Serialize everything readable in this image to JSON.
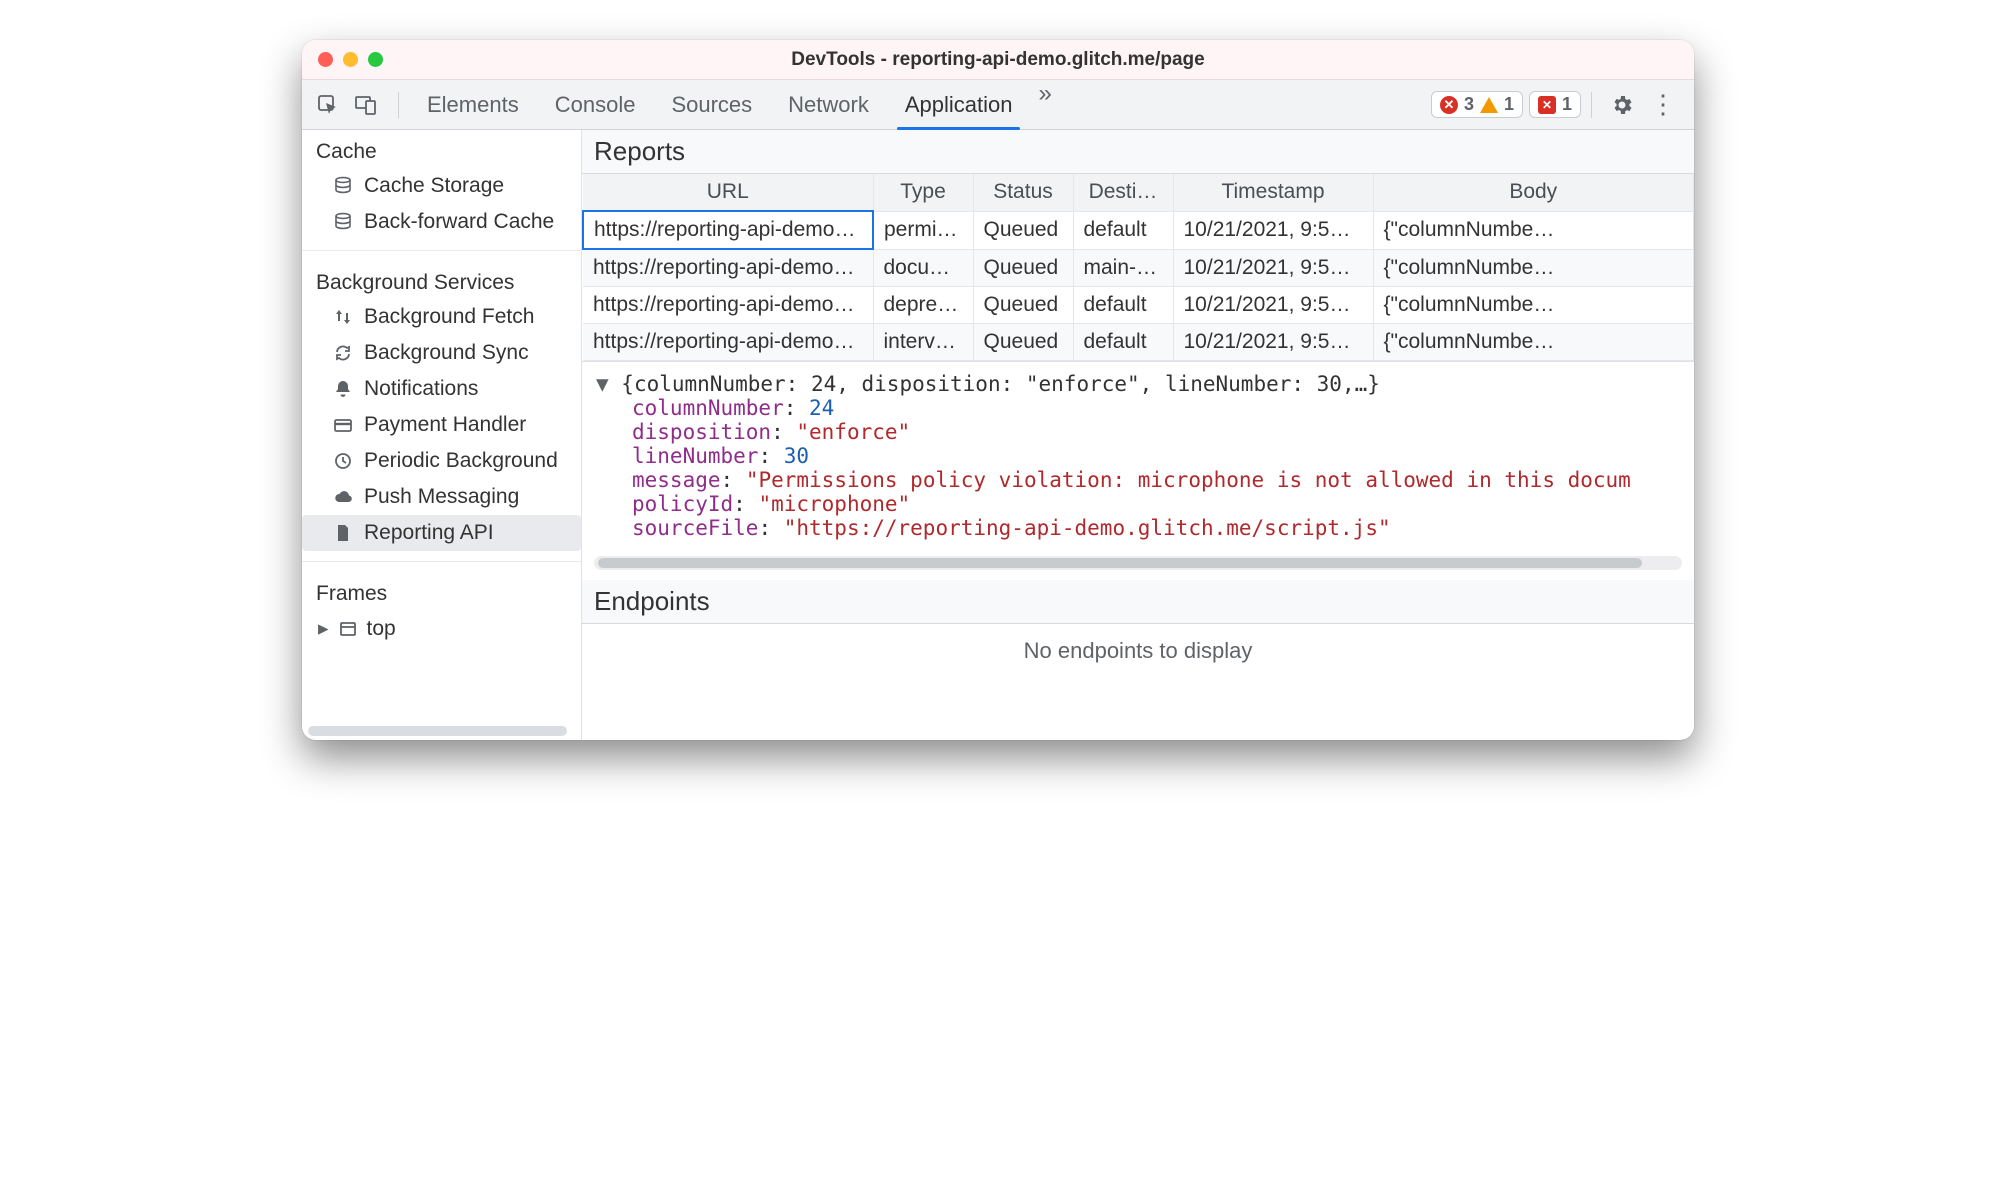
{
  "window": {
    "title": "DevTools - reporting-api-demo.glitch.me/page"
  },
  "toolbar": {
    "tabs": [
      "Elements",
      "Console",
      "Sources",
      "Network",
      "Application"
    ],
    "active": "Application",
    "errors": "3",
    "warnings": "1",
    "issues": "1"
  },
  "sidebar": {
    "cache": {
      "title": "Cache",
      "items": [
        "Cache Storage",
        "Back-forward Cache"
      ]
    },
    "background": {
      "title": "Background Services",
      "items": [
        "Background Fetch",
        "Background Sync",
        "Notifications",
        "Payment Handler",
        "Periodic Background",
        "Push Messaging",
        "Reporting API"
      ],
      "selected": "Reporting API"
    },
    "frames": {
      "title": "Frames",
      "top": "top"
    }
  },
  "reports": {
    "header": "Reports",
    "columns": [
      "URL",
      "Type",
      "Status",
      "Desti…",
      "Timestamp",
      "Body"
    ],
    "rows": [
      {
        "url": "https://reporting-api-demo…",
        "type": "permi…",
        "status": "Queued",
        "dest": "default",
        "ts": "10/21/2021, 9:5…",
        "body": "{\"columnNumbe…"
      },
      {
        "url": "https://reporting-api-demo…",
        "type": "docu…",
        "status": "Queued",
        "dest": "main-…",
        "ts": "10/21/2021, 9:5…",
        "body": "{\"columnNumbe…"
      },
      {
        "url": "https://reporting-api-demo…",
        "type": "depre…",
        "status": "Queued",
        "dest": "default",
        "ts": "10/21/2021, 9:5…",
        "body": "{\"columnNumbe…"
      },
      {
        "url": "https://reporting-api-demo…",
        "type": "interv…",
        "status": "Queued",
        "dest": "default",
        "ts": "10/21/2021, 9:5…",
        "body": "{\"columnNumbe…"
      }
    ]
  },
  "detail": {
    "summary": "{columnNumber: 24, disposition: \"enforce\", lineNumber: 30,…}",
    "columnNumber": "24",
    "disposition": "\"enforce\"",
    "lineNumber": "30",
    "message": "\"Permissions policy violation: microphone is not allowed in this docum",
    "policyId": "\"microphone\"",
    "sourceFile": "\"https://reporting-api-demo.glitch.me/script.js\""
  },
  "endpoints": {
    "header": "Endpoints",
    "empty": "No endpoints to display"
  }
}
